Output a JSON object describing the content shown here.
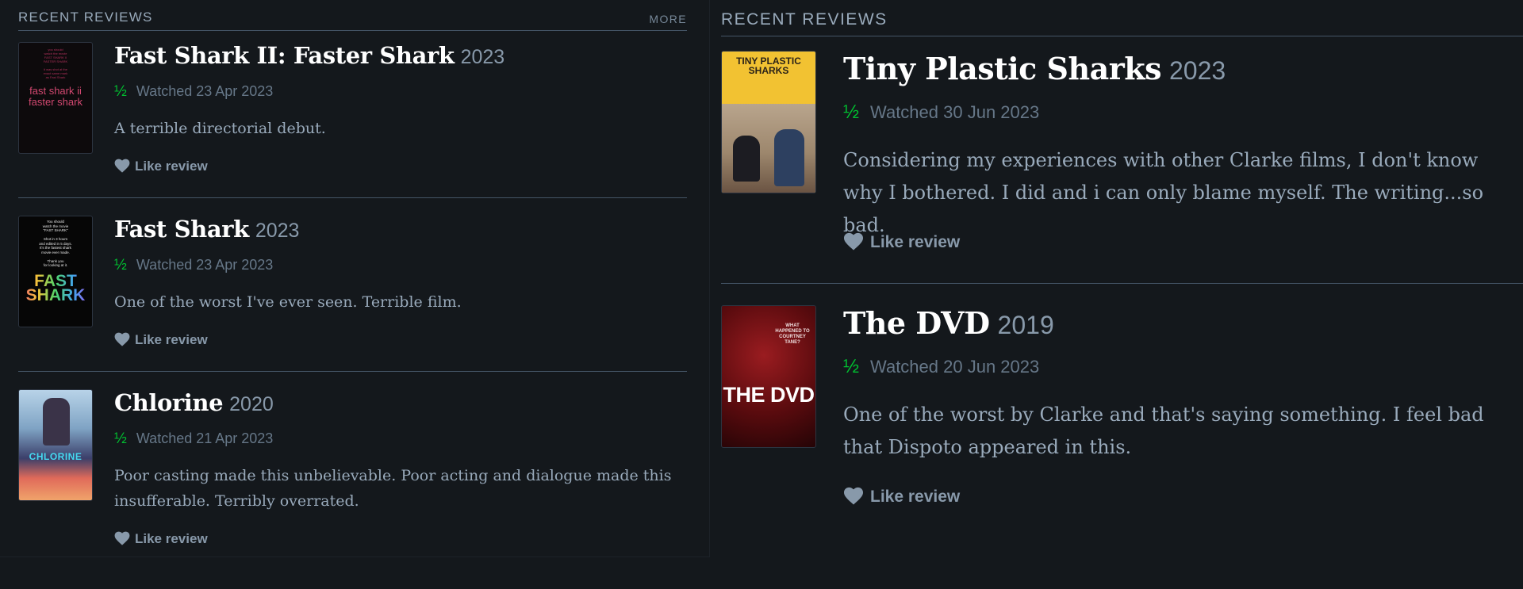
{
  "left": {
    "section_title": "RECENT REVIEWS",
    "more_label": "MORE",
    "reviews": [
      {
        "title": "Fast Shark II: Faster Shark",
        "year": "2023",
        "rating": "½",
        "watched": "Watched 23 Apr 2023",
        "text": "A terrible directorial debut.",
        "like": "Like review",
        "poster_title": "fast shark ii faster shark"
      },
      {
        "title": "Fast Shark",
        "year": "2023",
        "rating": "½",
        "watched": "Watched 23 Apr 2023",
        "text": "One of the worst I've ever seen. Terrible film.",
        "like": "Like review",
        "poster_title": "FAST SHARK"
      },
      {
        "title": "Chlorine",
        "year": "2020",
        "rating": "½",
        "watched": "Watched 21 Apr 2023",
        "text": "Poor casting made this unbelievable. Poor acting and dialogue made this insufferable. Terribly overrated.",
        "like": "Like review",
        "poster_title": "CHLORINE"
      }
    ]
  },
  "right": {
    "section_title": "RECENT REVIEWS",
    "reviews": [
      {
        "title": "Tiny Plastic Sharks",
        "year": "2023",
        "rating": "½",
        "watched": "Watched 30 Jun 2023",
        "text": "Considering my experiences with other Clarke films, I don't know why I bothered. I did and i can only blame myself. The writing...so bad.",
        "like": "Like review",
        "poster_title": "TINY PLASTIC SHARKS"
      },
      {
        "title": "The DVD",
        "year": "2019",
        "rating": "½",
        "watched": "Watched 20 Jun 2023",
        "text": "One of the worst by Clarke and that's saying something. I feel bad that Dispoto appeared in this.",
        "like": "Like review",
        "poster_title": "THE DVD",
        "poster_tagline": "WHAT HAPPENED TO COURTNEY TANE?"
      }
    ]
  },
  "colors": {
    "background": "#14181c",
    "rating_green": "#00c030",
    "title_white": "#ffffff",
    "muted_text": "#99aabb"
  },
  "icons": {
    "like": "heart-icon"
  }
}
